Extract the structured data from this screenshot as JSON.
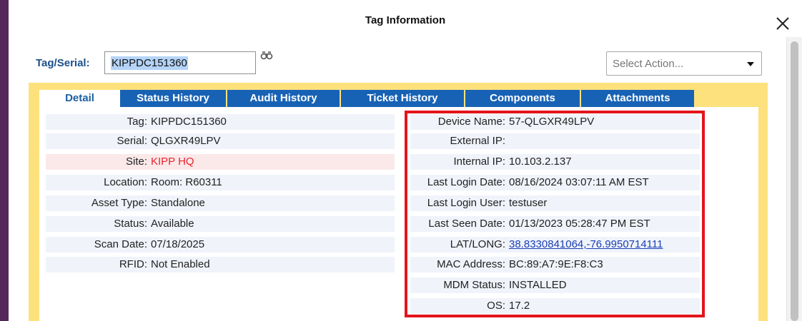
{
  "dialog": {
    "title": "Tag Information"
  },
  "search": {
    "label": "Tag/Serial:",
    "value": "KIPPDC151360"
  },
  "action_select": {
    "placeholder": "Select Action..."
  },
  "tabs": [
    {
      "label": "Detail",
      "active": true
    },
    {
      "label": "Status History",
      "active": false
    },
    {
      "label": "Audit History",
      "active": false
    },
    {
      "label": "Ticket History",
      "active": false
    },
    {
      "label": "Components",
      "active": false
    },
    {
      "label": "Attachments",
      "active": false
    }
  ],
  "left_fields": [
    {
      "label": "Tag:",
      "value": "KIPPDC151360"
    },
    {
      "label": "Serial:",
      "value": "QLGXR49LPV"
    },
    {
      "label": "Site:",
      "value": "KIPP HQ"
    },
    {
      "label": "Location:",
      "value": "Room: R60311"
    },
    {
      "label": "Asset Type:",
      "value": "Standalone"
    },
    {
      "label": "Status:",
      "value": "Available"
    },
    {
      "label": "Scan Date:",
      "value": "07/18/2025"
    },
    {
      "label": "RFID:",
      "value": "Not Enabled"
    }
  ],
  "right_fields": [
    {
      "label": "Device Name:",
      "value": "57-QLGXR49LPV"
    },
    {
      "label": "External IP:",
      "value": ""
    },
    {
      "label": "Internal IP:",
      "value": "10.103.2.137"
    },
    {
      "label": "Last Login Date:",
      "value": "08/16/2024 03:07:11 AM EST"
    },
    {
      "label": "Last Login User:",
      "value": "testuser"
    },
    {
      "label": "Last Seen Date:",
      "value": "01/13/2023 05:28:47 PM EST"
    },
    {
      "label": "LAT/LONG:",
      "value": "38.8330841064,-76.9950714111"
    },
    {
      "label": "MAC Address:",
      "value": "BC:89:A7:9E:F8:C3"
    },
    {
      "label": "MDM Status:",
      "value": "INSTALLED"
    },
    {
      "label": "OS:",
      "value": "17.2"
    }
  ],
  "colors": {
    "tab_blue": "#1862b5",
    "panel_yellow": "#fde17d",
    "label_blue": "#1b4f8a",
    "site_red": "#e8232c",
    "highlight_red": "#e3141c",
    "link_blue": "#1a3fb5"
  },
  "icons": {
    "close": "close-icon",
    "search": "binoculars-icon",
    "dropdown": "chevron-down-icon"
  }
}
